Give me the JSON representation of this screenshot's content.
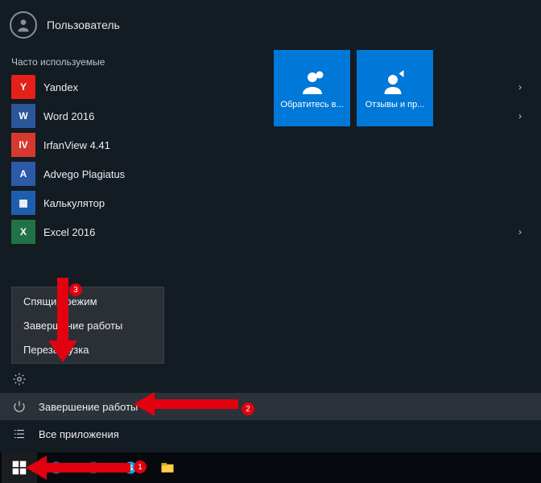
{
  "user": {
    "name": "Пользователь"
  },
  "section_label": "Часто используемые",
  "apps": [
    {
      "label": "Yandex",
      "badge": "Y",
      "cls": "ic-yandex",
      "has_sub": true
    },
    {
      "label": "Word 2016",
      "badge": "W",
      "cls": "ic-word",
      "has_sub": true
    },
    {
      "label": "IrfanView 4.41",
      "badge": "IV",
      "cls": "ic-irfan",
      "has_sub": false
    },
    {
      "label": "Advego Plagiatus",
      "badge": "A",
      "cls": "ic-advego",
      "has_sub": false
    },
    {
      "label": "Калькулятор",
      "badge": "▦",
      "cls": "ic-calc",
      "has_sub": false
    },
    {
      "label": "Excel 2016",
      "badge": "X",
      "cls": "ic-excel",
      "has_sub": true
    }
  ],
  "tiles": [
    {
      "label": "Обратитесь в..."
    },
    {
      "label": "Отзывы и пр..."
    }
  ],
  "submenu": {
    "items": [
      {
        "label": "Спящий режим"
      },
      {
        "label": "Завершение работы"
      },
      {
        "label": "Перезагрузка"
      }
    ]
  },
  "bottom": {
    "explorer_label": "",
    "settings_label": "",
    "power_label": "Завершение работы",
    "allapps_label": "Все приложения"
  },
  "annotations": {
    "1": "1",
    "2": "2",
    "3": "3"
  }
}
